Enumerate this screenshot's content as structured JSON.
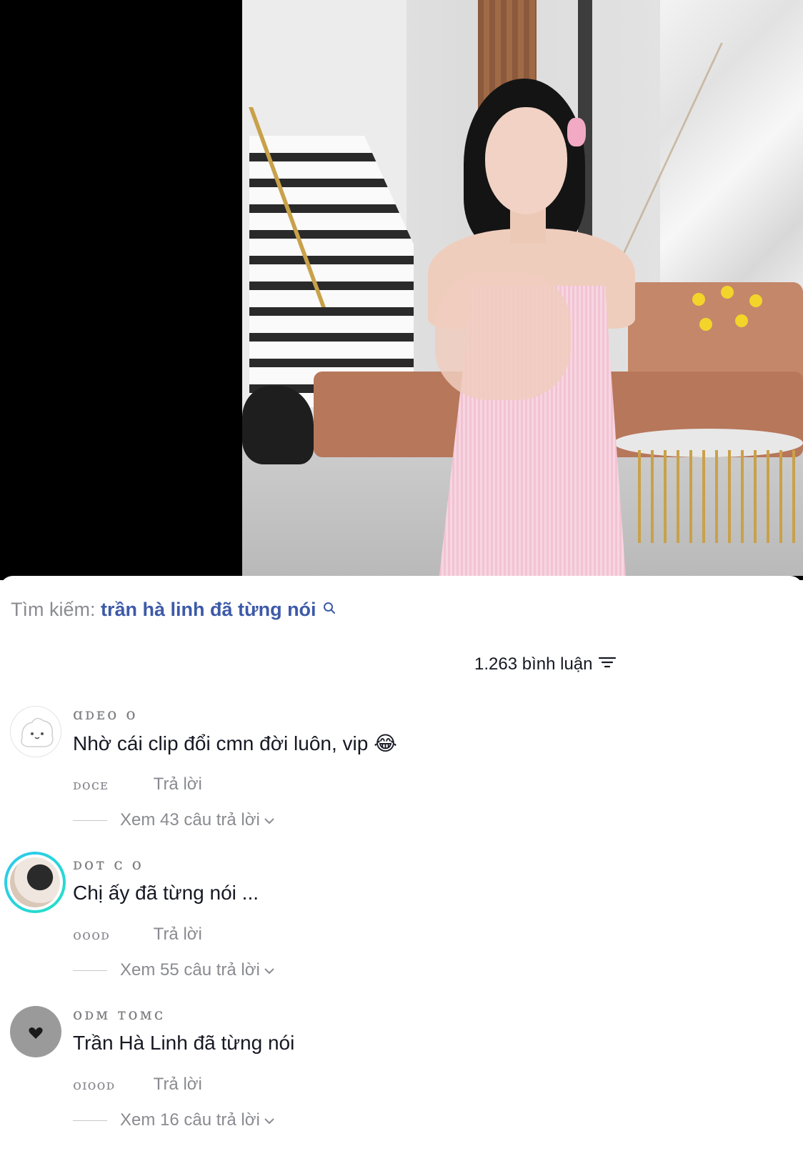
{
  "search": {
    "label": "Tìm kiếm:",
    "term": "trần hà linh đã từng nói"
  },
  "comments_header": {
    "count_text": "1.263 bình luận"
  },
  "comments": [
    {
      "username": "ɑᴅᴇᴏ ᴏ",
      "text": "Nhờ cái clip đổi cmn đời luôn, vip 😂",
      "date": "ᴅᴏᴄᴇ",
      "reply_label": "Trả lời",
      "view_replies": "Xem 43 câu trả lời"
    },
    {
      "username": "ᴅᴏᴛ ᴄ ᴏ",
      "text": "Chị ấy đã từng nói ...",
      "date": "ᴏᴏᴏᴅ",
      "reply_label": "Trả lời",
      "view_replies": "Xem 55 câu trả lời"
    },
    {
      "username": "ᴏᴅᴍ ᴛᴏᴍᴄ",
      "text": "Trần Hà Linh đã từng nói",
      "date": "ᴏɪᴏᴏᴅ",
      "reply_label": "Trả lời",
      "view_replies": "Xem 16 câu trả lời"
    }
  ],
  "colors": {
    "search_term": "#3d5aa8",
    "secondary_text": "#8a8b91",
    "story_ring": "#2dc8ef"
  }
}
